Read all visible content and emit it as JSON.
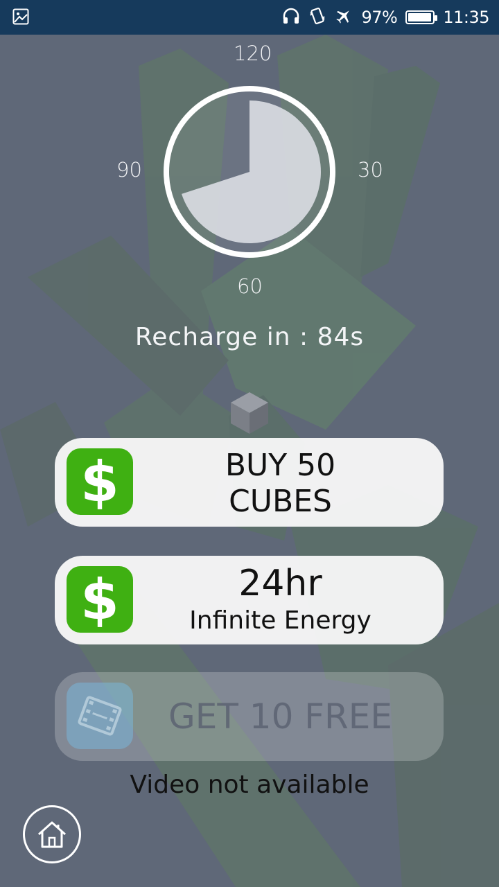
{
  "status_bar": {
    "battery": "97%",
    "time": "11:35",
    "icons": [
      "image-icon",
      "headphones-icon",
      "vibrate-icon",
      "airplane-icon",
      "battery-icon"
    ]
  },
  "dial": {
    "label_top": "120",
    "label_left": "90",
    "label_right": "30",
    "label_bottom": "60",
    "remaining_fraction": 0.7
  },
  "recharge_text": "Recharge in : 84s",
  "buttons": {
    "buy_cubes": {
      "line1": "BUY 50",
      "line2": "CUBES",
      "icon": "dollar-icon"
    },
    "infinite_energy": {
      "line1": "24hr",
      "line2": "Infinite Energy",
      "icon": "dollar-icon"
    },
    "get_free": {
      "label": "GET 10 FREE",
      "icon": "film-icon",
      "enabled": false
    }
  },
  "video_note": "Video not available",
  "home_button": {
    "icon": "home-icon"
  },
  "colors": {
    "status_bar": "#163a5c",
    "background": "#5f6878",
    "accent_green": "#3fb012",
    "button_bg": "#f7f7f7"
  }
}
